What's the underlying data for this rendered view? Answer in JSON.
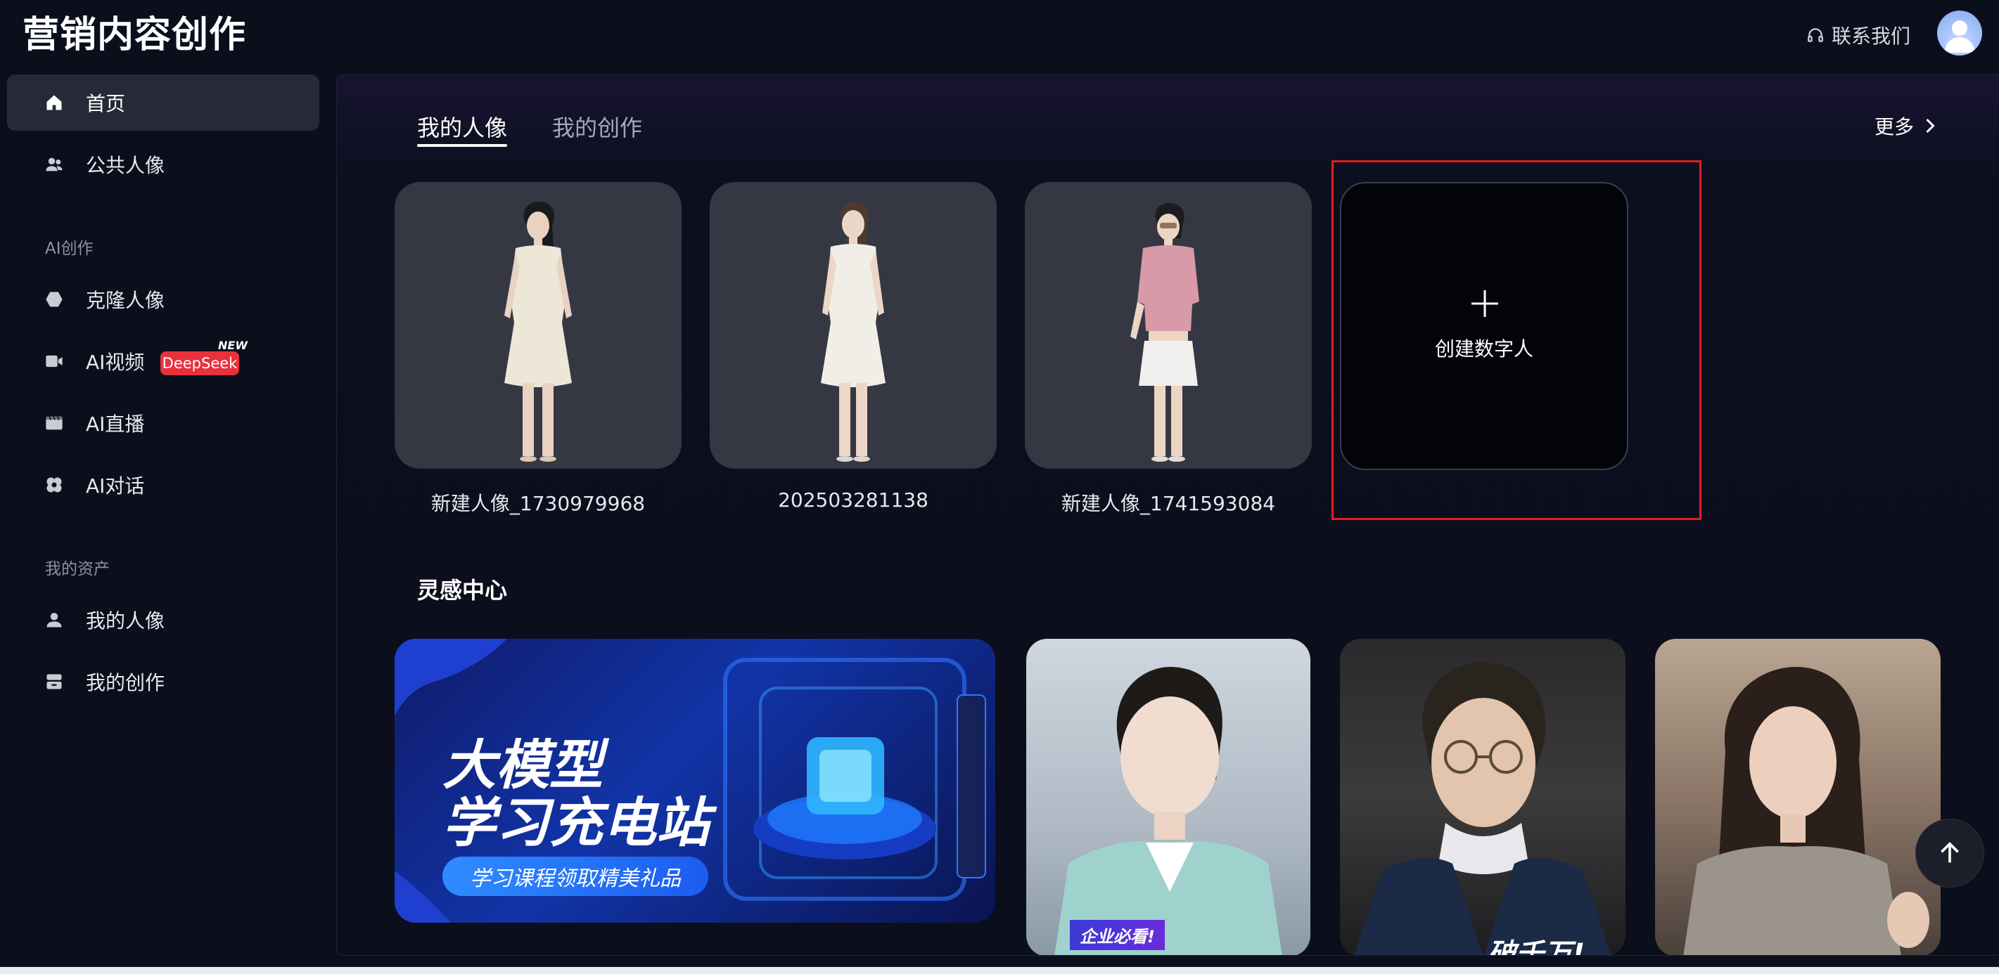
{
  "header": {
    "logo_text": "营销内容创作",
    "contact_label": "联系我们",
    "contact_icon": "headset-icon",
    "avatar_icon": "user-avatar"
  },
  "sidebar": {
    "items": [
      {
        "label": "首页",
        "icon": "home-icon",
        "active": true
      },
      {
        "label": "公共人像",
        "icon": "users-icon"
      }
    ],
    "section_ai": {
      "title": "AI创作",
      "items": [
        {
          "label": "克隆人像",
          "icon": "hexagon-icon"
        },
        {
          "label": "AI视频",
          "icon": "video-icon",
          "badge": "DeepSeek",
          "badge_tag": "NEW"
        },
        {
          "label": "AI直播",
          "icon": "clapperboard-icon"
        },
        {
          "label": "AI对话",
          "icon": "dialog-icon"
        }
      ]
    },
    "section_assets": {
      "title": "我的资产",
      "items": [
        {
          "label": "我的人像",
          "icon": "user-icon"
        },
        {
          "label": "我的创作",
          "icon": "box-icon"
        }
      ]
    }
  },
  "main": {
    "tabs": [
      {
        "label": "我的人像",
        "active": true
      },
      {
        "label": "我的创作"
      }
    ],
    "more_label": "更多",
    "portraits": [
      {
        "name": "新建人像_1730979968",
        "outfit": "cream-dress"
      },
      {
        "name": "202503281138",
        "outfit": "white-dress"
      },
      {
        "name": "新建人像_1741593084",
        "outfit": "pink-top"
      }
    ],
    "create_label": "创建数字人",
    "inspiration": {
      "title": "灵感中心",
      "banner": {
        "line1": "大模型",
        "line2": "学习充电站",
        "cta": "学习课程领取精美礼品"
      },
      "videos": [
        {
          "caption_tag": "企业必看!",
          "caption": ""
        },
        {
          "caption_tag": "",
          "caption": "破千万!"
        },
        {
          "caption_tag": "",
          "caption": ""
        }
      ]
    }
  },
  "colors": {
    "background": "#0b0f1c",
    "active_nav": "#262a38",
    "highlight": "#e0201e",
    "badge": "#e8313b",
    "card": "#353843"
  }
}
